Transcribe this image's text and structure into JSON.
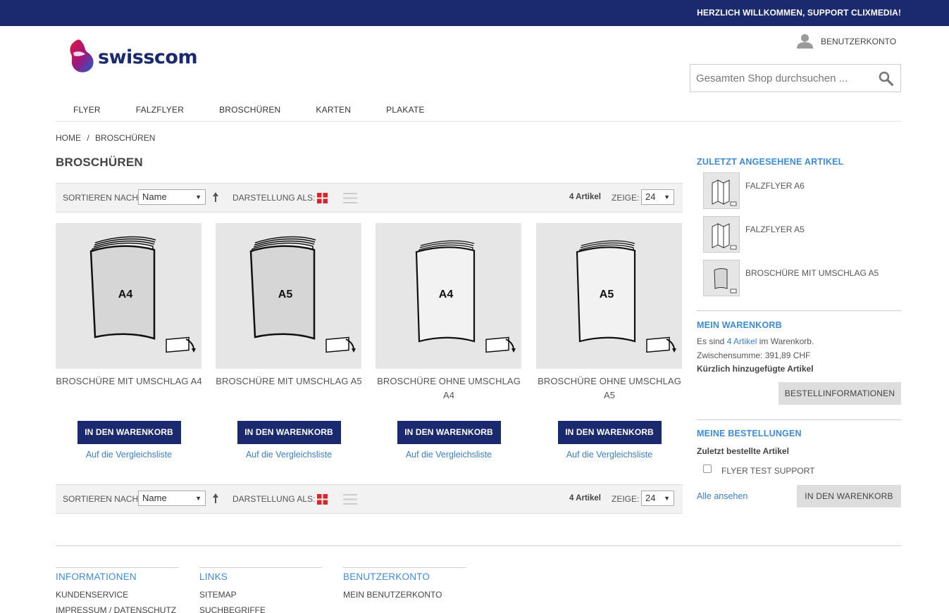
{
  "topbar": {
    "welcome": "HERZLICH WILLKOMMEN, SUPPORT CLIXMEDIA!"
  },
  "header": {
    "logo_text": "swisscom",
    "account_label": "BENUTZERKONTO",
    "search_placeholder": "Gesamten Shop durchsuchen ..."
  },
  "nav": [
    "FLYER",
    "FALZFLYER",
    "BROSCHÜREN",
    "KARTEN",
    "PLAKATE"
  ],
  "breadcrumb": {
    "home": "HOME",
    "sep": "/",
    "current": "BROSCHÜREN"
  },
  "page_title": "BROSCHÜREN",
  "toolbar": {
    "sort_label": "SORTIEREN NACH:",
    "sort_value": "Name",
    "view_label": "DARSTELLUNG ALS:",
    "count": "4 Artikel",
    "show_label": "ZEIGE:",
    "limit_value": "24"
  },
  "products": [
    {
      "name": "BROSCHÜRE MIT UMSCHLAG A4",
      "size": "A4",
      "cover": true
    },
    {
      "name": "BROSCHÜRE MIT UMSCHLAG A5",
      "size": "A5",
      "cover": true
    },
    {
      "name": "BROSCHÜRE OHNE UMSCHLAG A4",
      "size": "A4",
      "cover": false
    },
    {
      "name": "BROSCHÜRE OHNE UMSCHLAG A5",
      "size": "A5",
      "cover": false
    }
  ],
  "product_actions": {
    "cart": "IN DEN WARENKORB",
    "compare": "Auf die Vergleichsliste"
  },
  "sidebar": {
    "recent_title": "ZULETZT ANGESEHENE ARTIKEL",
    "recent": [
      "FALZFLYER A6",
      "FALZFLYER A5",
      "BROSCHÜRE MIT UMSCHLAG A5"
    ],
    "cart_title": "MEIN WARENKORB",
    "cart_text_pre": "Es sind ",
    "cart_link": "4 Artikel",
    "cart_text_post": " im Warenkorb.",
    "subtotal": "Zwischensumme: 391,89 CHF",
    "recently_added": "Kürzlich hinzugefügte Artikel",
    "order_info_btn": "BESTELLINFORMATIONEN",
    "orders_title": "MEINE BESTELLUNGEN",
    "last_ordered": "Zuletzt bestellte Artikel",
    "order_item": "FLYER TEST SUPPORT",
    "view_all": "Alle ansehen",
    "add_cart_btn": "IN DEN WARENKORB"
  },
  "footer": [
    {
      "title": "INFORMATIONEN",
      "links": [
        "KUNDENSERVICE",
        "IMPRESSUM / DATENSCHUTZ"
      ]
    },
    {
      "title": "LINKS",
      "links": [
        "SITEMAP",
        "SUCHBEGRIFFE"
      ]
    },
    {
      "title": "BENUTZERKONTO",
      "links": [
        "MEIN BENUTZERKONTO"
      ]
    }
  ],
  "colors": {
    "brand_navy": "#1b2a6e",
    "link_blue": "#3d7ec9",
    "heading_blue": "#3d8bd9",
    "grid_red": "#d9232d"
  }
}
